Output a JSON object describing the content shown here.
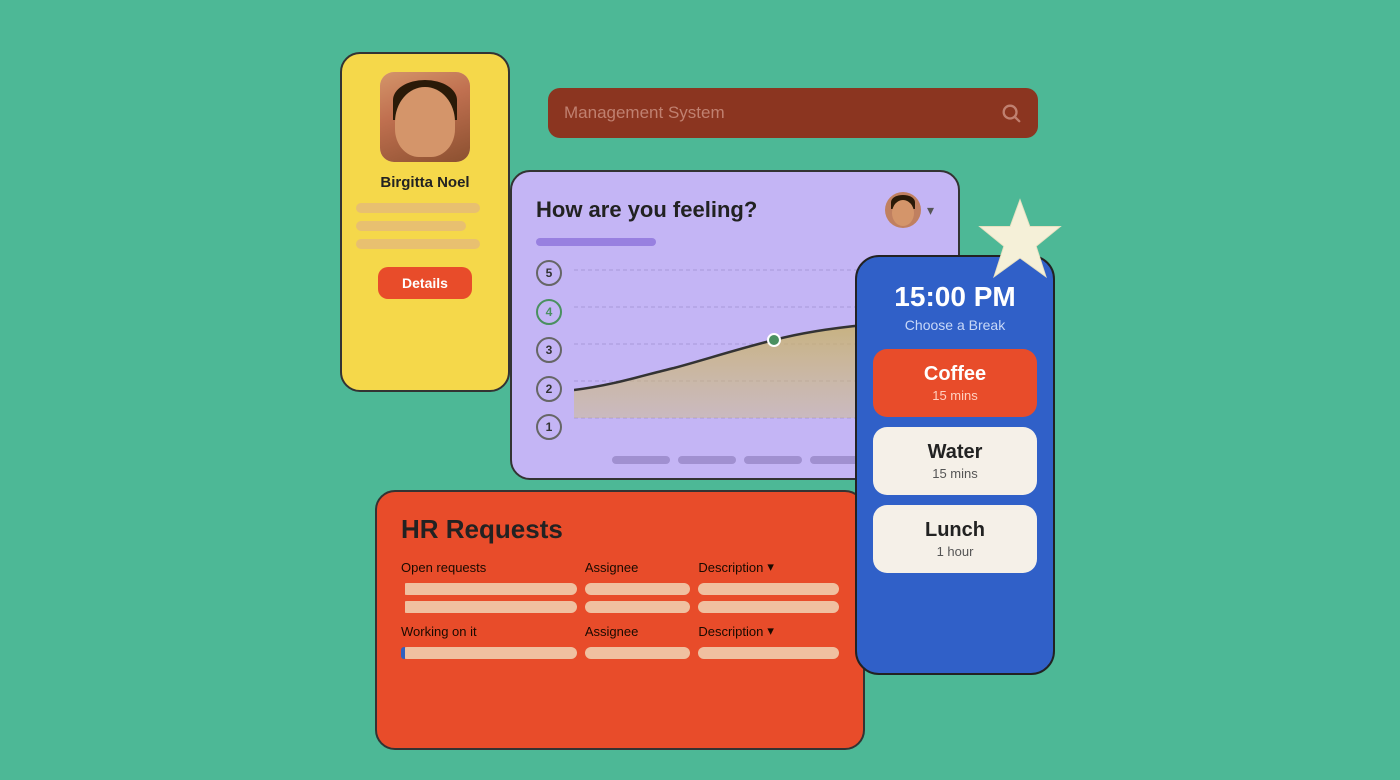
{
  "background": "#4db896",
  "search": {
    "placeholder": "Management System",
    "icon": "search"
  },
  "profile": {
    "name": "Birgitta Noel",
    "details_label": "Details"
  },
  "feeling": {
    "title": "How are you feeling?",
    "y_labels": [
      "5",
      "4",
      "3",
      "2",
      "1"
    ],
    "active_label": "4"
  },
  "hr": {
    "title": "HR Requests",
    "open_label": "Open requests",
    "assignee_label": "Assignee",
    "description_label": "Description",
    "working_label": "Working on it",
    "working_assignee": "Assignee",
    "working_description": "Description"
  },
  "break_chooser": {
    "time": "15:00 PM",
    "subtitle": "Choose a Break",
    "options": [
      {
        "title": "Coffee",
        "duration": "15 mins",
        "active": true
      },
      {
        "title": "Water",
        "duration": "15 mins",
        "active": false
      },
      {
        "title": "Lunch",
        "duration": "1 hour",
        "active": false
      }
    ]
  }
}
